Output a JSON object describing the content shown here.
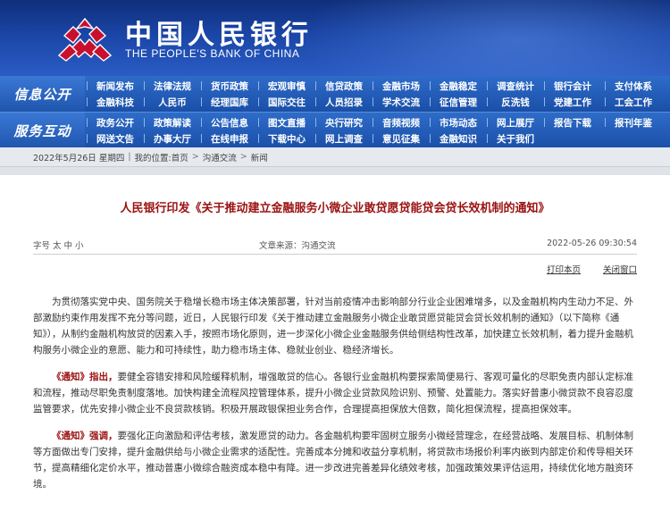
{
  "header": {
    "logo_cn": "中国人民银行",
    "logo_en": "THE PEOPLE'S BANK OF CHINA",
    "brand_color": "#1d57b5"
  },
  "nav": {
    "section1": "信息公开",
    "section2": "服务互动",
    "row1": [
      [
        "新闻发布",
        "法律法规",
        "货币政策",
        "宏观审慎",
        "信贷政策",
        "金融市场",
        "金融稳定",
        "调查统计",
        "银行会计",
        "支付体系"
      ],
      [
        "金融科技",
        "人民币",
        "经理国库",
        "国际交往",
        "人员招录",
        "学术交流",
        "征信管理",
        "反洗钱",
        "党建工作",
        "工会工作"
      ]
    ],
    "row2": [
      [
        "政务公开",
        "政策解读",
        "公告信息",
        "图文直播",
        "央行研究",
        "音频视频",
        "市场动态",
        "网上展厅",
        "报告下载",
        "报刊年鉴"
      ],
      [
        "网送文告",
        "办事大厅",
        "在线申报",
        "下载中心",
        "网上调查",
        "意见征集",
        "金融知识",
        "关于我们"
      ]
    ]
  },
  "breadcrumb": {
    "date": "2022年5月26日 星期四",
    "location_label": "我的位置:首页",
    "level1": "沟通交流",
    "level2": "新闻"
  },
  "article": {
    "title": "人民银行印发《关于推动建立金融服务小微企业敢贷愿贷能贷会贷长效机制的通知》",
    "font_size": "字号 太 中 小",
    "source": "文章来源：沟通交流",
    "datetime": "2022-05-26  09:30:54",
    "print_label": "打印本页",
    "close_label": "关闭窗口",
    "p1": "为贯彻落实党中央、国务院关于稳增长稳市场主体决策部署，针对当前疫情冲击影响部分行业企业困难增多，以及金融机构内生动力不足、外部激励约束作用发挥不充分等问题，近日，人民银行印发《关于推动建立金融服务小微企业敢贷愿贷能贷会贷长效机制的通知》（以下简称《通知》），从制约金融机构放贷的因素入手，按照市场化原则，进一步深化小微企业金融服务供给侧结构性改革，加快建立长效机制，着力提升金融机构服务小微企业的意愿、能力和可持续性，助力稳市场主体、稳就业创业、稳经济增长。",
    "p2_lead": "《通知》指出，",
    "p2": "要健全容错安排和风险缓释机制，增强敢贷的信心。各银行业金融机构要探索简便易行、客观可量化的尽职免责内部认定标准和流程，推动尽职免责制度落地。加快构建全流程风控管理体系，提升小微企业贷款风险识别、预警、处置能力。落实好普惠小微贷款不良容忍度监管要求，优先安排小微企业不良贷款核销。积极开展政银保担业务合作，合理提高担保放大倍数，简化担保流程，提高担保效率。",
    "p3_lead": "《通知》强调，",
    "p3": "要强化正向激励和评估考核，激发愿贷的动力。各金融机构要牢固树立服务小微经营理念，在经营战略、发展目标、机制体制等方面做出专门安排，提升金融供给与小微企业需求的适配性。完善成本分摊和收益分享机制，将贷款市场报价利率内嵌到内部定价和传导相关环节，提高精细化定价水平，推动普惠小微综合融资成本稳中有降。进一步改进完善差异化绩效考核，加强政策效果评估运用，持续优化地方融资环境。"
  }
}
